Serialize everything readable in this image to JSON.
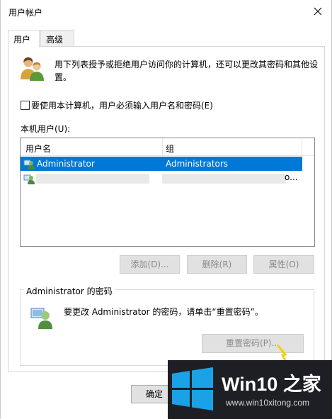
{
  "window": {
    "title": "用户帐户"
  },
  "tabs": [
    {
      "label": "用户",
      "active": true
    },
    {
      "label": "高级",
      "active": false
    }
  ],
  "intro_text": "用下列表授予或拒绝用户访问你的计算机，还可以更改其密码和其他设置。",
  "require_login_checkbox": {
    "label": "要使用本计算机，用户必须输入用户名和密码(E)",
    "checked": false
  },
  "users_list": {
    "label": "本机用户(U):",
    "columns": [
      "用户名",
      "组"
    ],
    "rows": [
      {
        "name": "Administrator",
        "group": "Administrators",
        "selected": true
      },
      {
        "name": "",
        "group": "",
        "trailing": "o..."
      }
    ]
  },
  "buttons": {
    "add": "添加(D)...",
    "remove": "删除(R)",
    "properties": "属性(O)"
  },
  "password_group": {
    "title": "Administrator 的密码",
    "text": "要更改 Administrator 的密码，请单击“重置密码”。",
    "reset_button": "重置密码(P)..."
  },
  "footer": {
    "ok": "确定"
  },
  "watermark": {
    "name": "Win10 之家",
    "url": "www.win10xitong.com"
  },
  "colors": {
    "selection": "#0078d7",
    "brand_bg": "#1e1f24",
    "win_blue": "#1aa1e6"
  }
}
